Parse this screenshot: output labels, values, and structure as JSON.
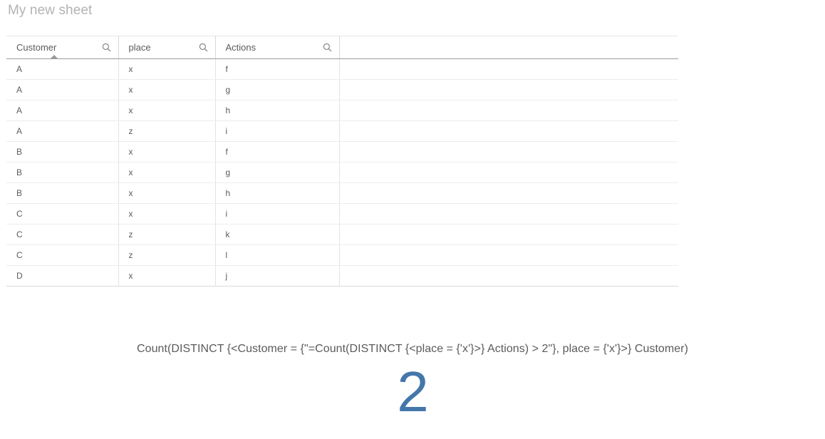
{
  "sheet": {
    "title": "My new sheet"
  },
  "table": {
    "columns": [
      {
        "label": "Customer",
        "icon": "search-icon",
        "sorted": true,
        "sort_direction": "ascending"
      },
      {
        "label": "place",
        "icon": "search-icon",
        "sorted": false
      },
      {
        "label": "Actions",
        "icon": "search-icon",
        "sorted": false
      },
      {
        "label": "",
        "icon": "search-icon",
        "sorted": false
      }
    ],
    "rows": [
      {
        "customer": "A",
        "place": "x",
        "actions": "f",
        "blank": ""
      },
      {
        "customer": "A",
        "place": "x",
        "actions": "g",
        "blank": ""
      },
      {
        "customer": "A",
        "place": "x",
        "actions": "h",
        "blank": ""
      },
      {
        "customer": "A",
        "place": "z",
        "actions": "i",
        "blank": ""
      },
      {
        "customer": "B",
        "place": "x",
        "actions": "f",
        "blank": ""
      },
      {
        "customer": "B",
        "place": "x",
        "actions": "g",
        "blank": ""
      },
      {
        "customer": "B",
        "place": "x",
        "actions": "h",
        "blank": ""
      },
      {
        "customer": "C",
        "place": "x",
        "actions": "i",
        "blank": ""
      },
      {
        "customer": "C",
        "place": "z",
        "actions": "k",
        "blank": ""
      },
      {
        "customer": "C",
        "place": "z",
        "actions": "l",
        "blank": ""
      },
      {
        "customer": "D",
        "place": "x",
        "actions": "j",
        "blank": ""
      }
    ]
  },
  "kpi": {
    "expression": "Count(DISTINCT {<Customer = {\"=Count(DISTINCT {<place = {'x'}>} Actions) > 2\"}, place = {'x'}>} Customer)",
    "value": "2"
  },
  "colors": {
    "kpi_value": "#4477aa",
    "title": "#b3b3b3",
    "text": "#5b5b5b",
    "header_rule": "#9a9a9a",
    "row_rule": "#ededed"
  }
}
